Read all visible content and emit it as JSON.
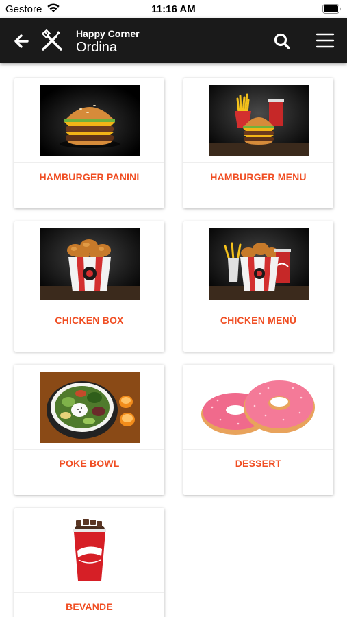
{
  "status_bar": {
    "carrier": "Gestore",
    "time": "11:16 AM"
  },
  "header": {
    "app_name": "Happy Corner",
    "subtitle": "Ordina"
  },
  "accent_color": "#f04e23",
  "header_color": "#1a1a1a",
  "categories": [
    {
      "label": "HAMBURGER PANINI",
      "icon": "burger-image"
    },
    {
      "label": "HAMBURGER MENU",
      "icon": "burger-menu-image"
    },
    {
      "label": "CHICKEN BOX",
      "icon": "chicken-box-image"
    },
    {
      "label": "CHICKEN MENÙ",
      "icon": "chicken-menu-image"
    },
    {
      "label": "POKE BOWL",
      "icon": "poke-bowl-image"
    },
    {
      "label": "DESSERT",
      "icon": "donuts-image"
    },
    {
      "label": "BEVANDE",
      "icon": "drink-cup-image"
    }
  ]
}
